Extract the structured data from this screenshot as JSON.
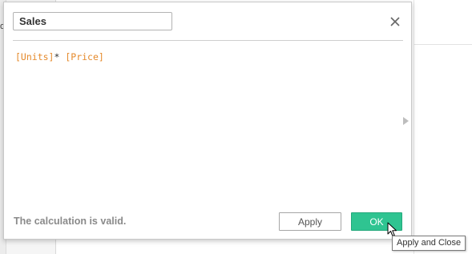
{
  "background": {
    "left_fragment": "o"
  },
  "dialog": {
    "title_value": "Sales",
    "close_icon": "close-x-icon",
    "formula": {
      "field_1": "[Units]",
      "operator": "*",
      "field_2": "[Price]"
    },
    "expand_icon": "caret-right-icon",
    "status": "The calculation is valid.",
    "apply_label": "Apply",
    "ok_label": "OK"
  },
  "tooltip": {
    "text": "Apply and Close"
  },
  "colors": {
    "ok_button": "#2fc491",
    "field_token": "#e58a2c"
  }
}
